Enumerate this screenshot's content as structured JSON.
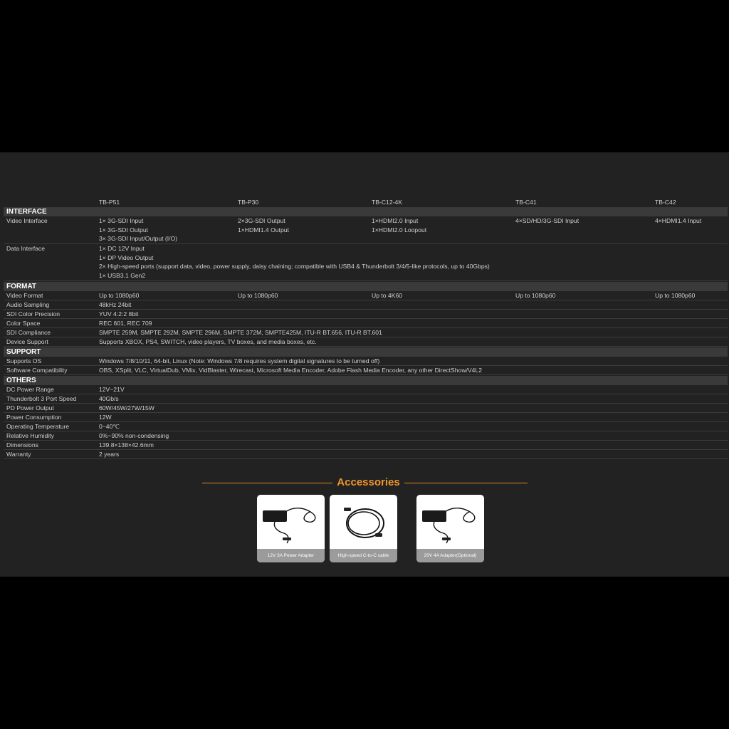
{
  "models": [
    "TB-P51",
    "TB-P30",
    "TB-C12-4K",
    "TB-C41",
    "TB-C42"
  ],
  "sections": {
    "interface": {
      "title": "INTERFACE",
      "video_interface": {
        "label": "Video Interface",
        "c1": [
          "1× 3G-SDI Input",
          "1× 3G-SDI Output",
          "3× 3G-SDI Input/Output (I/O)"
        ],
        "c2": [
          "2×3G-SDI Output",
          "1×HDMI1.4 Output"
        ],
        "c3": [
          "1×HDMI2.0 Input",
          "1×HDMI2.0 Loopout"
        ],
        "c4": "4×SD/HD/3G-SDI Input",
        "c5": "4×HDMI1.4 Input"
      },
      "data_interface": {
        "label": "Data Interface",
        "lines": [
          "1× DC 12V Input",
          "1× DP Video Output",
          "2× High-speed ports (support data, video, power supply, daisy chaining; compatible with USB4 & Thunderbolt 3/4/5-like protocols, up to 40Gbps)",
          "1× USB3.1 Gen2"
        ]
      }
    },
    "format": {
      "title": "FORMAT",
      "video_format": {
        "label": "Video Format",
        "c1": "Up to 1080p60",
        "c2": "Up to 1080p60",
        "c3": "Up to 4K60",
        "c4": "Up to 1080p60",
        "c5": "Up to 1080p60"
      },
      "audio_sampling": {
        "label": "Audio Sampling",
        "value": "48kHz 24bit"
      },
      "sdi_color_precision": {
        "label": "SDI Color Precision",
        "value": "YUV 4:2:2 8bit"
      },
      "color_space": {
        "label": "Color Space",
        "value": "REC 601, REC 709"
      },
      "sdi_compliance": {
        "label": "SDI Compliance",
        "value": "SMPTE 259M, SMPTE 292M, SMPTE 296M, SMPTE 372M, SMPTE425M, ITU-R BT.656, ITU-R BT.601"
      },
      "device_support": {
        "label": "Device Support",
        "value": "Supports XBOX, PS4, SWITCH, video players, TV boxes, and media boxes, etc."
      }
    },
    "support": {
      "title": "SUPPORT",
      "supports_os": {
        "label": "Supports OS",
        "value": "Windows 7/8/10/11, 64-bit, Linux (Note: Windows 7/8 requires system digital signatures to be turned off)"
      },
      "software": {
        "label": "Software Compatibility",
        "value": "OBS, XSplit, VLC, VirtualDub, VMix, VidBlaster, Wirecast, Microsoft Media Encoder, Adobe Flash Media Encoder, any other DirectShow/V4L2"
      }
    },
    "others": {
      "title": "OTHERS",
      "dc_power": {
        "label": "DC Power Range",
        "value": "12V~21V"
      },
      "tb3_speed": {
        "label": "Thunderbolt 3 Port Speed",
        "value": "40Gb/s"
      },
      "pd_output": {
        "label": "PD Power Output",
        "value": "60W/45W/27W/15W"
      },
      "power_consumption": {
        "label": "Power Consumption",
        "value": "12W"
      },
      "operating_temp": {
        "label": "Operating Temperature",
        "value": "0~40℃"
      },
      "humidity": {
        "label": "Relative Humidity",
        "value": "0%~90% non-condensing"
      },
      "dimensions": {
        "label": "Dimensions",
        "value": "139.8×138×42.6mm"
      },
      "warranty": {
        "label": "Warranty",
        "value": "2 years"
      }
    }
  },
  "accessories": {
    "title": "Accessories",
    "items": [
      {
        "caption": "12V 3A Power Adapter",
        "icon": "power-adapter-icon"
      },
      {
        "caption": "High-speed C-to-C cable",
        "icon": "usb-c-cable-icon"
      },
      {
        "caption": "20V 4A Adapter(Optional)",
        "icon": "power-adapter-icon"
      }
    ]
  },
  "colors": {
    "panel": "#222222",
    "section_bar": "#3a3a3a",
    "accent": "#f0962a"
  }
}
